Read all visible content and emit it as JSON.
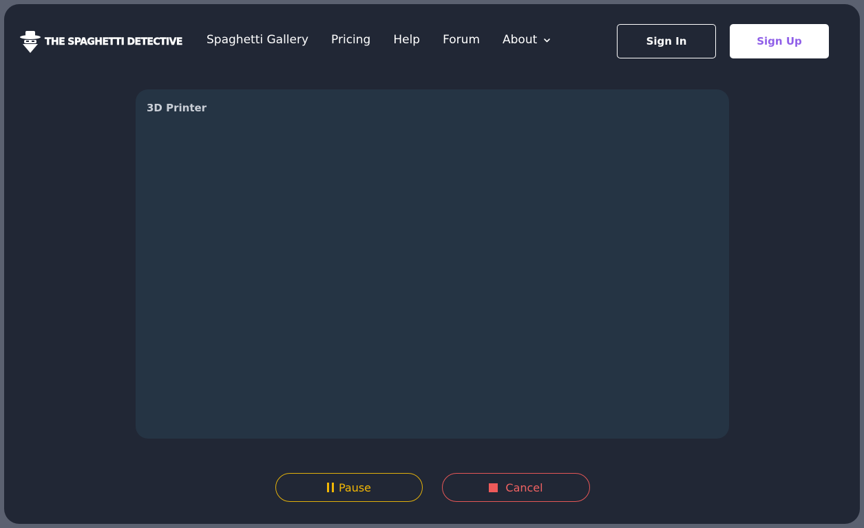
{
  "header": {
    "brand_name": "THE SPAGHETTI DETECTIVE",
    "logo_icon": "detective-logo-icon",
    "nav_links": [
      "Spaghetti Gallery",
      "Pricing",
      "Help",
      "Forum",
      "About"
    ],
    "about_dropdown_icon": "chevron-down-icon",
    "sign_in_label": "Sign In",
    "sign_up_label": "Sign Up"
  },
  "printer_panel": {
    "title": "3D Printer"
  },
  "controls": {
    "pause_label": "Pause",
    "pause_icon": "pause-icon",
    "cancel_label": "Cancel",
    "cancel_icon": "stop-icon"
  },
  "colors": {
    "background": "#212735",
    "card": "#253444",
    "sign_up_text": "#8f5fe8",
    "pause": "#f2b705",
    "cancel": "#f06262"
  }
}
